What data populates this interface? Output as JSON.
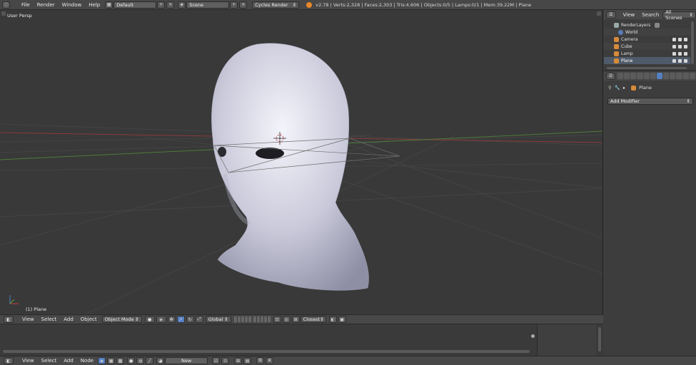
{
  "topbar": {
    "menus": [
      "File",
      "Render",
      "Window",
      "Help"
    ],
    "screen_layout": "Default",
    "scene": "Scene",
    "engine": "Cycles Render",
    "stats": "v2.78 | Verts:2,328 | Faces:2,303 | Tris:4,606 | Objects:0/5 | Lamps:0/1 | Mem:39.22M | Plane"
  },
  "viewport": {
    "label": "User Persp",
    "object_label": "(1) Plane"
  },
  "view3d_header": {
    "menus": [
      "View",
      "Select",
      "Add",
      "Object"
    ],
    "mode": "Object Mode",
    "orientation": "Global",
    "snap": "Closest"
  },
  "node_header": {
    "menus": [
      "View",
      "Select",
      "Add",
      "Node"
    ],
    "new_label": "New"
  },
  "outliner": {
    "tabs": [
      "View",
      "Search",
      "All Scenes"
    ],
    "rows": [
      {
        "label": "RenderLayers"
      },
      {
        "label": "World"
      },
      {
        "label": "Camera"
      },
      {
        "label": "Cube"
      },
      {
        "label": "Lamp"
      },
      {
        "label": "Plane"
      }
    ]
  },
  "properties": {
    "object_name": "Plane",
    "add_modifier": "Add Modifier"
  },
  "colors": {
    "accent": "#5680c2",
    "grid_red": "#8a3a3a",
    "grid_green": "#4e7a3a"
  }
}
